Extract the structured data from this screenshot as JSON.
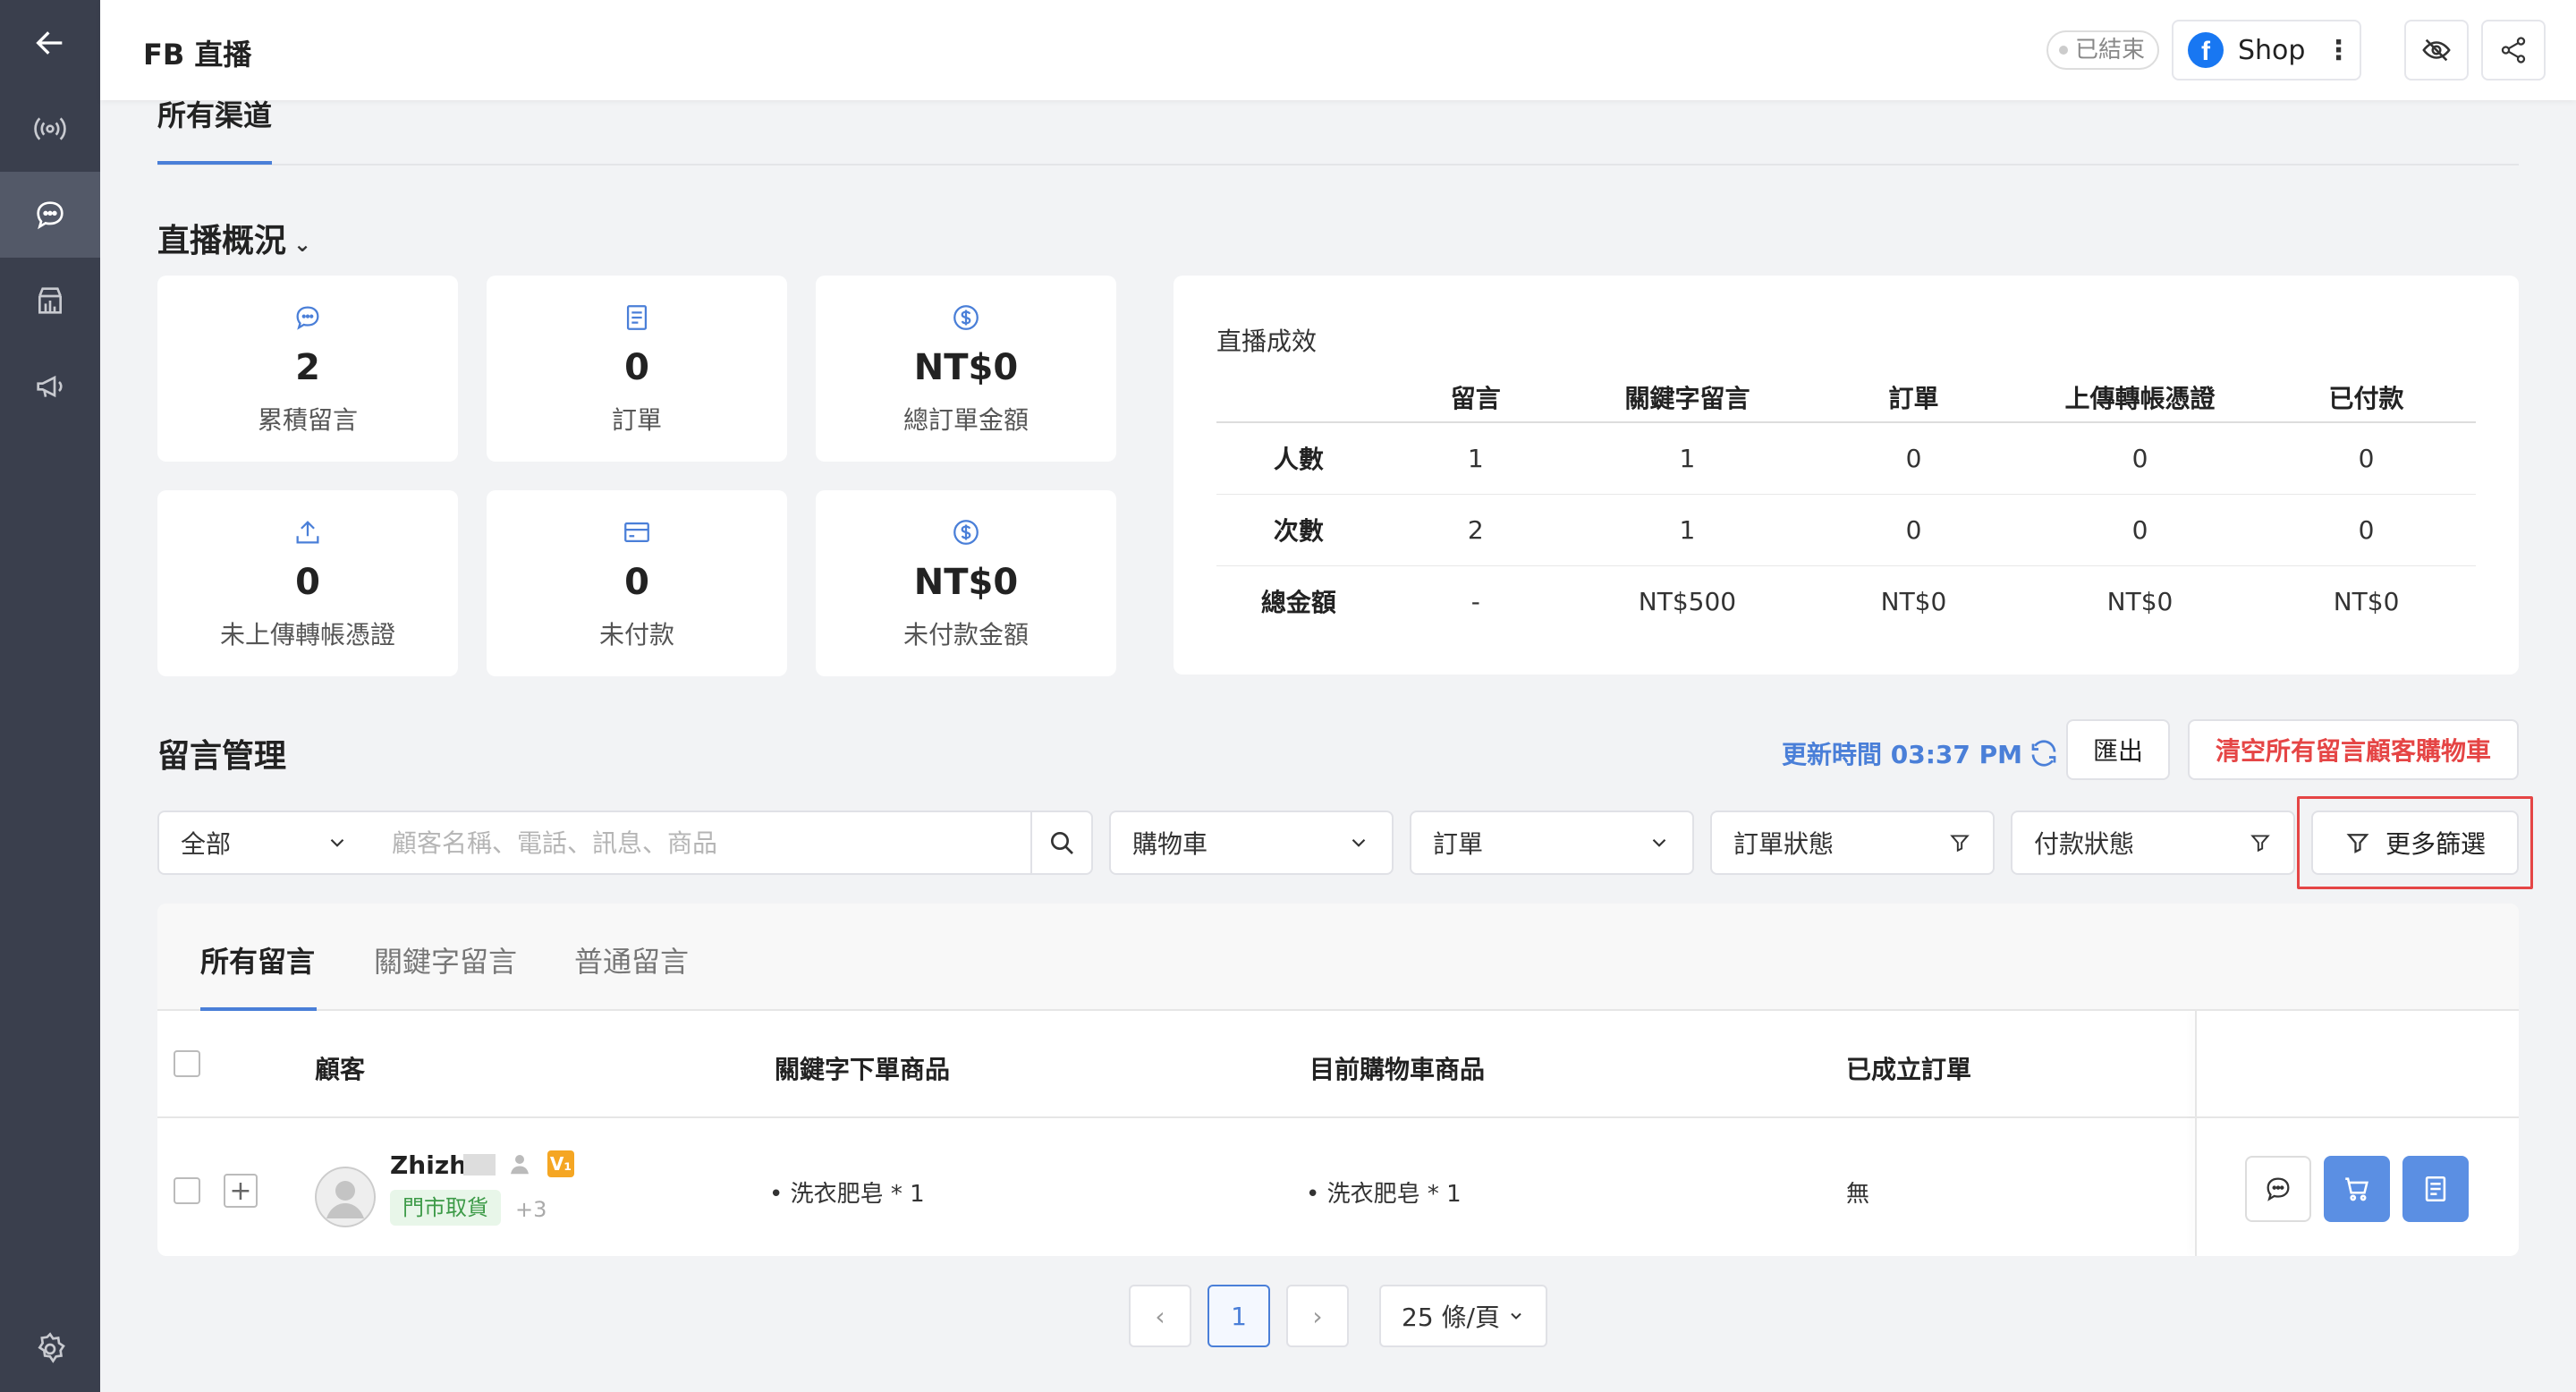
{
  "header": {
    "title": "FB 直播",
    "status_badge": "已結束",
    "shop_label": "Shop",
    "kebab": "⋮",
    "fb_glyph": "f"
  },
  "channel_tab": "所有渠道",
  "overview": {
    "title": "直播概況",
    "stats": [
      {
        "icon": "comment-icon",
        "value": "2",
        "label": "累積留言"
      },
      {
        "icon": "order-icon",
        "value": "0",
        "label": "訂單"
      },
      {
        "icon": "dollar-icon",
        "value": "NT$0",
        "label": "總訂單金額"
      },
      {
        "icon": "upload-icon",
        "value": "0",
        "label": "未上傳轉帳憑證"
      },
      {
        "icon": "card-icon",
        "value": "0",
        "label": "未付款"
      },
      {
        "icon": "dollar-icon",
        "value": "NT$0",
        "label": "未付款金額"
      }
    ]
  },
  "performance": {
    "title": "直播成效",
    "columns": [
      "",
      "留言",
      "關鍵字留言",
      "訂單",
      "上傳轉帳憑證",
      "已付款"
    ],
    "rows": [
      [
        "人數",
        "1",
        "1",
        "0",
        "0",
        "0"
      ],
      [
        "次數",
        "2",
        "1",
        "0",
        "0",
        "0"
      ],
      [
        "總金額",
        "-",
        "NT$500",
        "NT$0",
        "NT$0",
        "NT$0"
      ]
    ]
  },
  "comments": {
    "title": "留言管理",
    "update_time": "更新時間 03:37 PM",
    "export_label": "匯出",
    "clear_label": "清空所有留言顧客購物車",
    "filters": {
      "scope": "全部",
      "search_placeholder": "顧客名稱、電話、訊息、商品",
      "cart": "購物車",
      "order": "訂單",
      "order_status": "訂單狀態",
      "payment_status": "付款狀態",
      "more": "更多篩選"
    },
    "tabs": [
      "所有留言",
      "關鍵字留言",
      "普通留言"
    ],
    "columns": {
      "customer": "顧客",
      "keyword_products": "關鍵字下單商品",
      "cart_products": "目前購物車商品",
      "created_orders": "已成立訂單"
    },
    "rows": [
      {
        "name": "Zhizhi",
        "vip": "V₁",
        "tag": "門市取貨",
        "more_tags": "+3",
        "expand": "+",
        "keyword_product": "•  洗衣肥皂  * 1",
        "cart_product": "•  洗衣肥皂  * 1",
        "order": "無"
      }
    ]
  },
  "pagination": {
    "current": "1",
    "prev": "‹",
    "next": "›",
    "page_size": "25 條/頁"
  },
  "colors": {
    "accent": "#4a7fd8",
    "danger": "#e54545",
    "sidebar": "#3a3f4d"
  }
}
